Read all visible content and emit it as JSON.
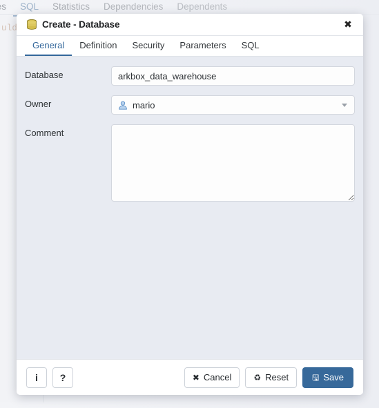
{
  "background": {
    "tabs": [
      {
        "label": "ties",
        "active": false
      },
      {
        "label": "SQL",
        "active": true
      },
      {
        "label": "Statistics",
        "active": false
      },
      {
        "label": "Dependencies",
        "active": false
      },
      {
        "label": "Dependents",
        "active": false
      }
    ],
    "editor_snippet": "uld",
    "editor_text_color": "#bd8f6a"
  },
  "dialog": {
    "title": "Create - Database",
    "title_icon": "database-icon",
    "close_icon": "✖",
    "accent_color": "#33679b",
    "tabs": [
      {
        "label": "General",
        "active": true
      },
      {
        "label": "Definition",
        "active": false
      },
      {
        "label": "Security",
        "active": false
      },
      {
        "label": "Parameters",
        "active": false
      },
      {
        "label": "SQL",
        "active": false
      }
    ],
    "form": {
      "database": {
        "label": "Database",
        "value": "arkbox_data_warehouse",
        "placeholder": ""
      },
      "owner": {
        "label": "Owner",
        "value": "mario",
        "icon": "user-icon",
        "caret_icon": "chevron-down-icon"
      },
      "comment": {
        "label": "Comment",
        "value": "",
        "placeholder": ""
      }
    },
    "footer": {
      "info_label": "i",
      "help_label": "?",
      "cancel_label": "Cancel",
      "cancel_icon": "✖",
      "reset_label": "Reset",
      "reset_icon": "♻",
      "save_label": "Save",
      "save_icon": "🖫",
      "save_color": "#37699a"
    }
  }
}
